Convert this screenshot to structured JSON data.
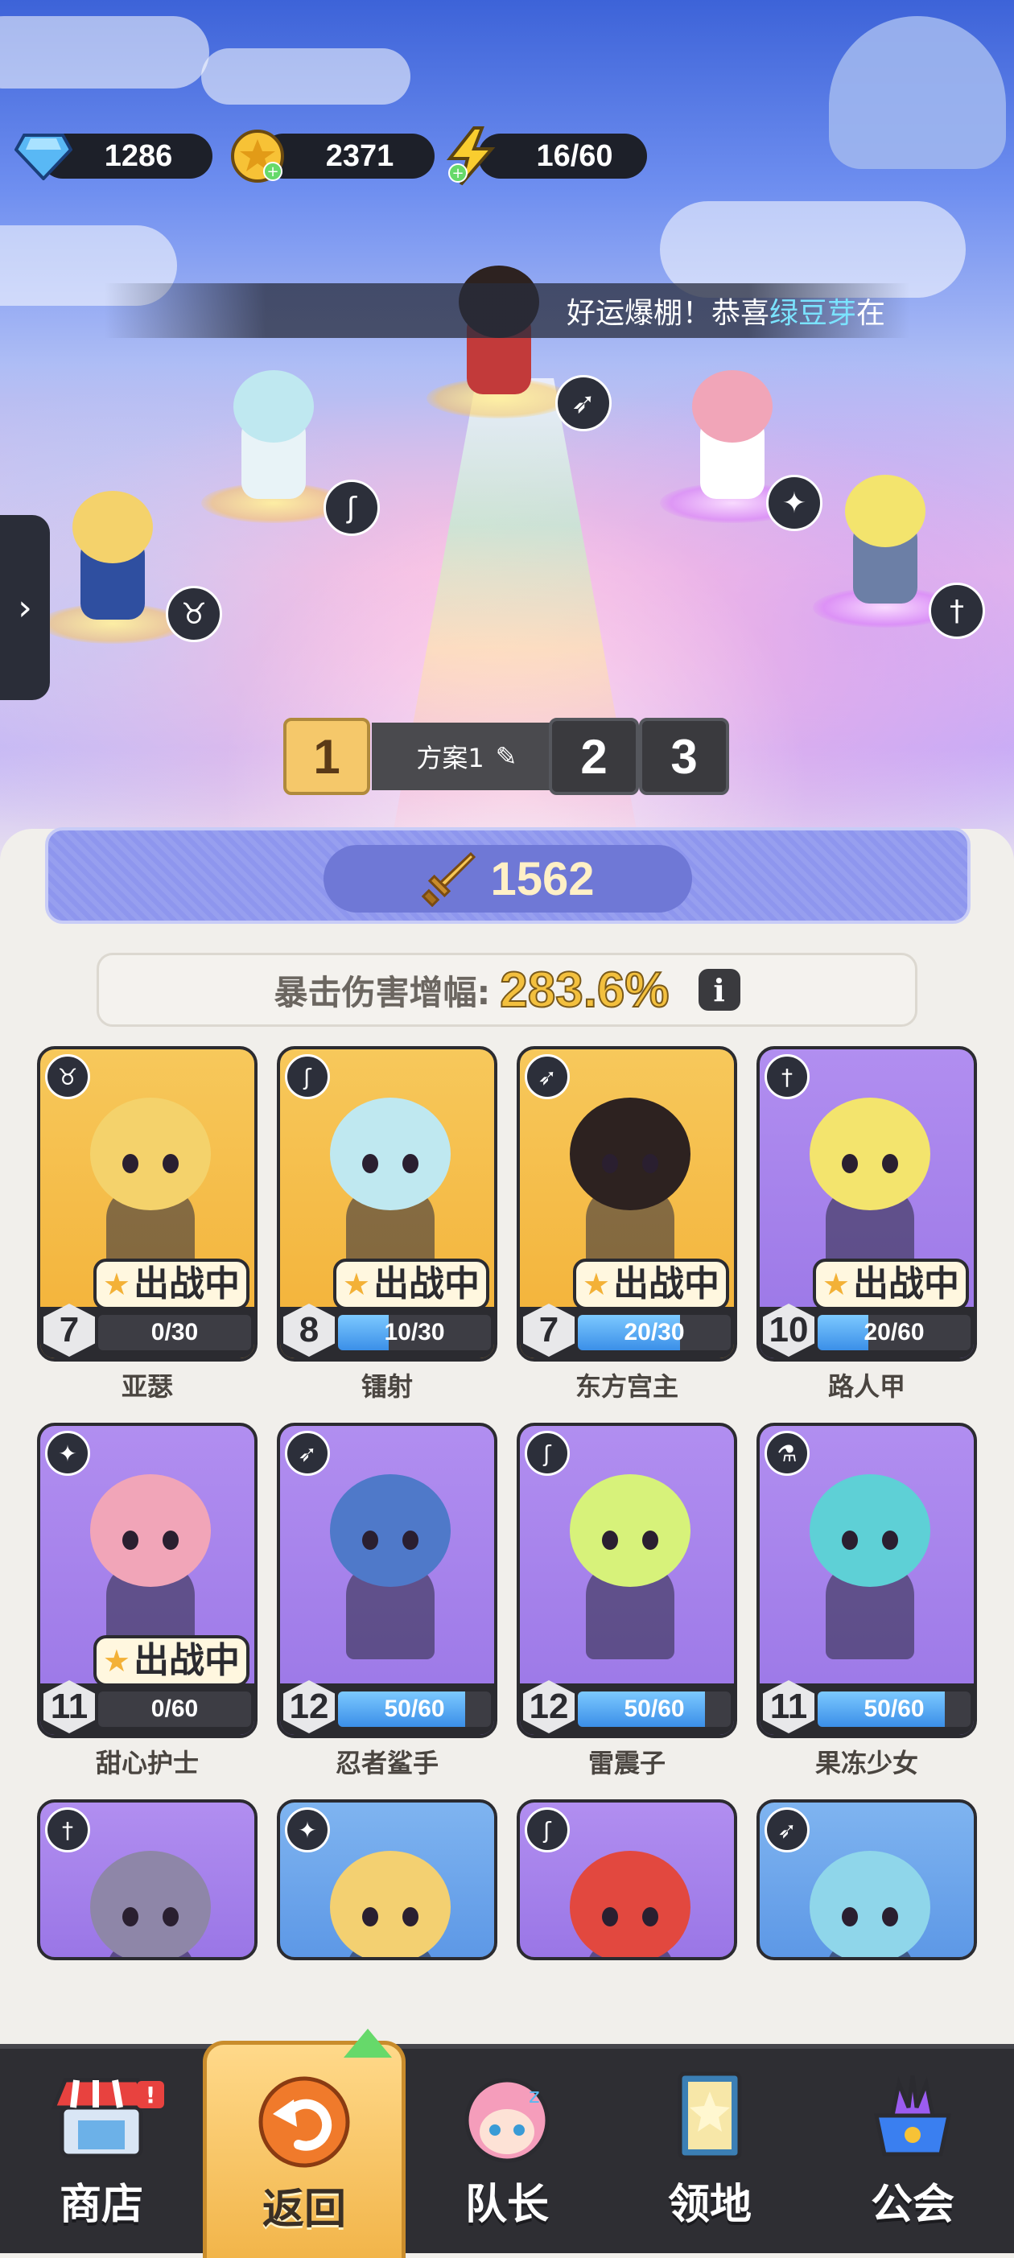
{
  "currencies": {
    "gems": "1286",
    "gold": "2371",
    "energy": "16/60"
  },
  "announcement": {
    "prefix": "好运爆棚！恭喜",
    "player": "绿豆芽",
    "suffix": "在"
  },
  "plans": {
    "tabs": [
      "1",
      "2",
      "3"
    ],
    "active_name": "方案1"
  },
  "power": "1562",
  "crit": {
    "label": "暴击伤害增幅:",
    "value": "283.6%",
    "info_icon": "i"
  },
  "battle_label": "出战中",
  "heroes": [
    {
      "name": "亚瑟",
      "level": "7",
      "shards": "0/30",
      "progress": 0,
      "frame": "gold",
      "in_battle": true,
      "role": "tank-icon",
      "color": "#f4d26b"
    },
    {
      "name": "镭射",
      "level": "8",
      "shards": "10/30",
      "progress": 0.33,
      "frame": "gold",
      "in_battle": true,
      "role": "mage-icon",
      "color": "#bfe8f0"
    },
    {
      "name": "东方宫主",
      "level": "7",
      "shards": "20/30",
      "progress": 0.67,
      "frame": "gold",
      "in_battle": true,
      "role": "archer-icon",
      "color": "#2d2220"
    },
    {
      "name": "路人甲",
      "level": "10",
      "shards": "20/60",
      "progress": 0.33,
      "frame": "purple",
      "in_battle": true,
      "role": "warrior-icon",
      "color": "#f3e46d"
    },
    {
      "name": "甜心护士",
      "level": "11",
      "shards": "0/60",
      "progress": 0,
      "frame": "purple",
      "in_battle": true,
      "role": "support-icon",
      "color": "#f1a5b8"
    },
    {
      "name": "忍者鲨手",
      "level": "12",
      "shards": "50/60",
      "progress": 0.83,
      "frame": "purple",
      "in_battle": false,
      "role": "archer-icon",
      "color": "#4f79c9"
    },
    {
      "name": "雷震子",
      "level": "12",
      "shards": "50/60",
      "progress": 0.83,
      "frame": "purple",
      "in_battle": false,
      "role": "mage-icon",
      "color": "#d7f27a"
    },
    {
      "name": "果冻少女",
      "level": "11",
      "shards": "50/60",
      "progress": 0.83,
      "frame": "purple",
      "in_battle": false,
      "role": "potion-icon",
      "color": "#5ed0d6"
    },
    {
      "name": "",
      "level": "",
      "shards": "",
      "progress": 0,
      "frame": "purple",
      "in_battle": false,
      "role": "warrior-icon",
      "color": "#8e86a8"
    },
    {
      "name": "",
      "level": "",
      "shards": "",
      "progress": 0,
      "frame": "blue",
      "in_battle": false,
      "role": "support-icon",
      "color": "#f3d071"
    },
    {
      "name": "",
      "level": "",
      "shards": "",
      "progress": 0,
      "frame": "purple",
      "in_battle": false,
      "role": "mage-icon",
      "color": "#e2483f"
    },
    {
      "name": "",
      "level": "",
      "shards": "",
      "progress": 0,
      "frame": "blue",
      "in_battle": false,
      "role": "archer-icon",
      "color": "#8fd6ea"
    }
  ],
  "nav": [
    {
      "label": "商店",
      "icon": "shop-icon",
      "badge": "!"
    },
    {
      "label": "返回",
      "icon": "return-icon",
      "active": true
    },
    {
      "label": "队长",
      "icon": "captain-icon"
    },
    {
      "label": "领地",
      "icon": "territory-icon"
    },
    {
      "label": "公会",
      "icon": "guild-icon"
    }
  ],
  "colors": {
    "gold_frame": "#f3b137",
    "purple_frame": "#9a76e6",
    "nav_bg": "#2e2e33",
    "crit_value": "#f3c03e"
  }
}
